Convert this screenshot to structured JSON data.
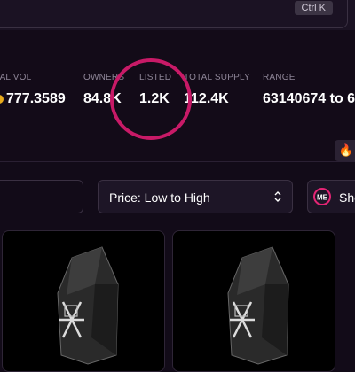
{
  "header": {
    "shortcut_hint": "Ctrl K"
  },
  "stats": {
    "items": [
      {
        "label": "TAL VOL",
        "value": "777.3589",
        "has_sol_icon": true
      },
      {
        "label": "OWNERS",
        "value": "84.8K"
      },
      {
        "label": "LISTED",
        "value": "1.2K"
      },
      {
        "label": "TOTAL SUPPLY",
        "value": "112.4K"
      },
      {
        "label": "RANGE",
        "value": "63140674 to 6"
      }
    ],
    "highlighted": "LISTED"
  },
  "filters": {
    "sort_label": "Price: Low to High",
    "show_label": "Sho"
  },
  "icons": {
    "fire": "fire-icon",
    "sort_chevron": "chevron-up-down-icon",
    "brand_logo": "magic-eden-logo-icon",
    "sol": "sol-coin-icon"
  },
  "colors": {
    "background": "#120b18",
    "highlight_ring": "#c81a67",
    "sol_coin": "#e8ab1c",
    "logo_accent": "#e42575"
  }
}
